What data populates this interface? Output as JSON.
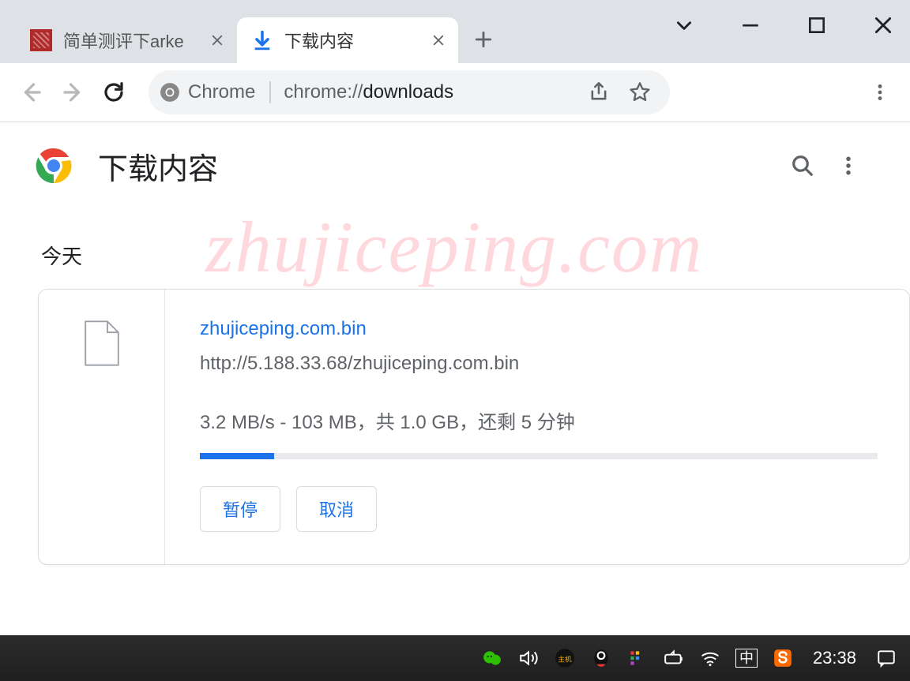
{
  "tabs": [
    {
      "title": "简单测评下arke",
      "active": false
    },
    {
      "title": "下载内容",
      "active": true
    }
  ],
  "omnibox": {
    "chip_label": "Chrome",
    "url_prefix": "chrome://",
    "url_bold": "downloads"
  },
  "page": {
    "title": "下载内容",
    "date_label": "今天"
  },
  "download": {
    "filename": "zhujiceping.com.bin",
    "url": "http://5.188.33.68/zhujiceping.com.bin",
    "status": "3.2 MB/s - 103 MB，共 1.0 GB，还剩 5 分钟",
    "progress_percent": 11,
    "pause_label": "暂停",
    "cancel_label": "取消"
  },
  "watermark": "zhujiceping.com",
  "taskbar": {
    "ime": "中",
    "clock": "23:38"
  }
}
